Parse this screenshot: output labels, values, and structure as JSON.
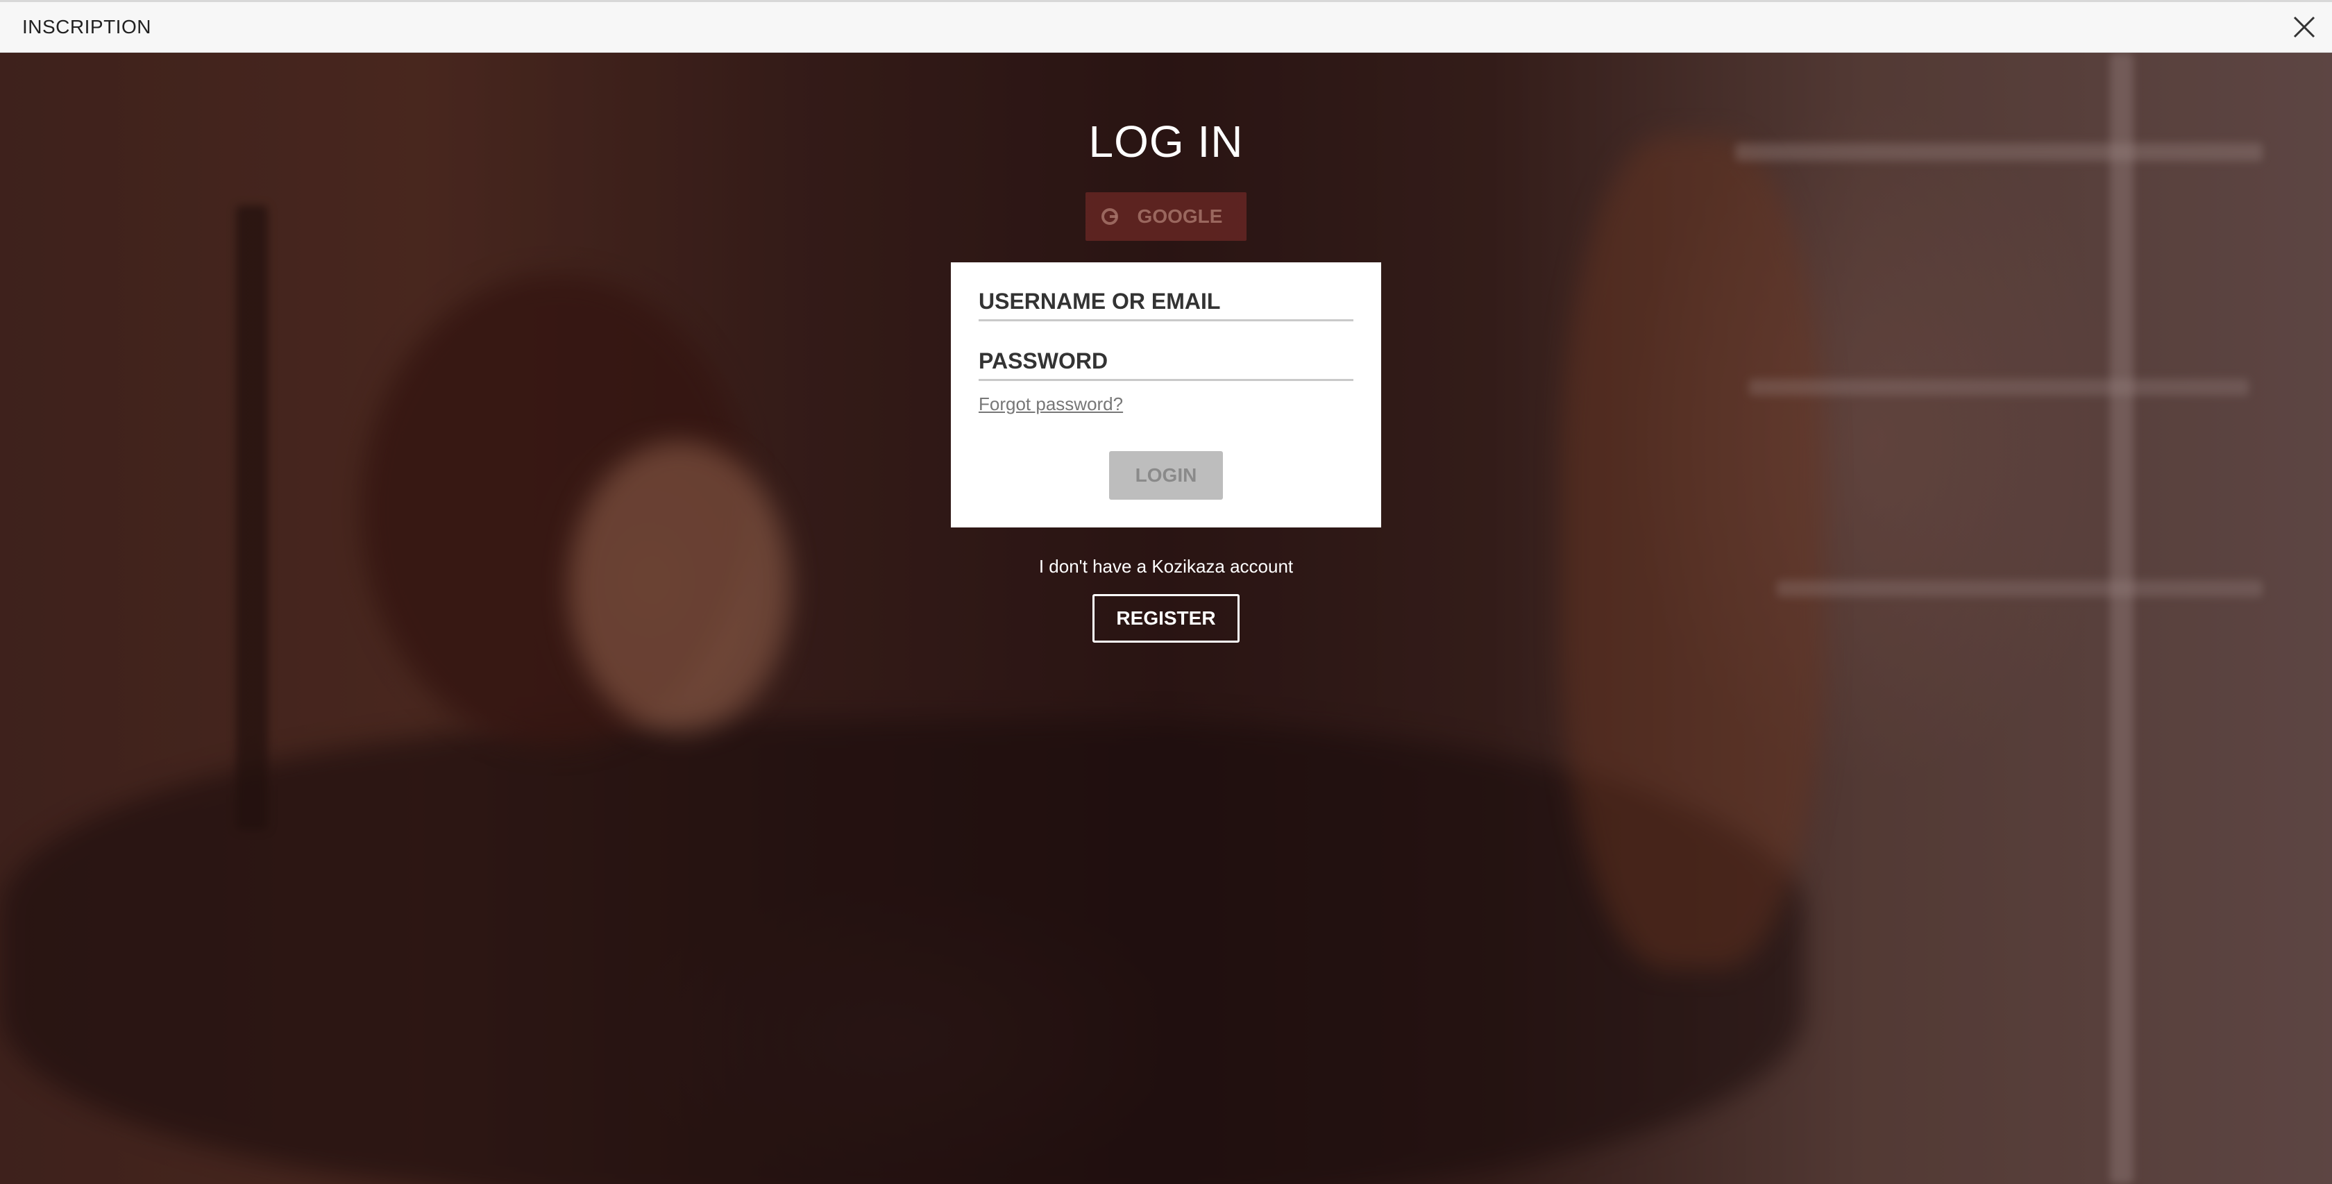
{
  "header": {
    "title": "INSCRIPTION",
    "close_icon": "close-icon"
  },
  "login": {
    "title": "LOG IN",
    "google_label": "GOOGLE",
    "username_label": "USERNAME OR EMAIL",
    "password_label": "PASSWORD",
    "forgot_label": "Forgot password?",
    "login_label": "LOGIN"
  },
  "register": {
    "prompt": "I don't have a Kozikaza account",
    "button_label": "REGISTER"
  },
  "colors": {
    "card_bg": "#ffffff",
    "login_button_bg": "#bdbdbd",
    "google_button_bg": "#6e2826",
    "header_bg": "#f7f7f7"
  }
}
